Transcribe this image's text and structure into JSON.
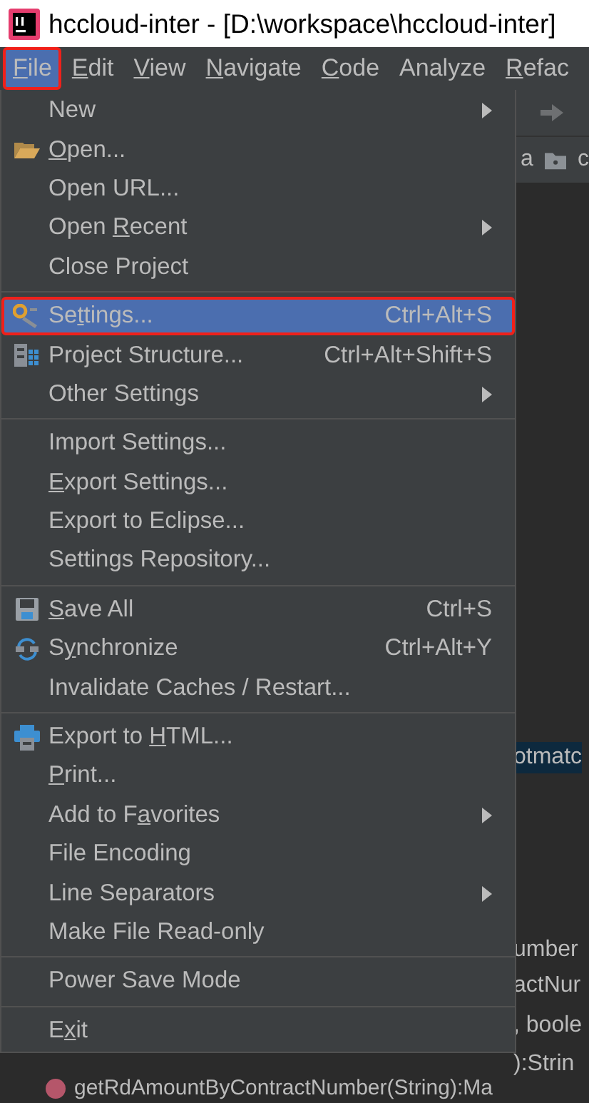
{
  "window": {
    "title": "hccloud-inter - [D:\\workspace\\hccloud-inter]"
  },
  "menu_bar": [
    {
      "label": [
        {
          "text": "F",
          "underlined": true
        },
        {
          "text": "ile",
          "underlined": false
        }
      ],
      "selected": true,
      "highlighted": true
    },
    {
      "label": [
        {
          "text": "E",
          "underlined": true
        },
        {
          "text": "dit",
          "underlined": false
        }
      ],
      "selected": false,
      "highlighted": false
    },
    {
      "label": [
        {
          "text": "V",
          "underlined": true
        },
        {
          "text": "iew",
          "underlined": false
        }
      ],
      "selected": false,
      "highlighted": false
    },
    {
      "label": [
        {
          "text": "N",
          "underlined": true
        },
        {
          "text": "avigate",
          "underlined": false
        }
      ],
      "selected": false,
      "highlighted": false
    },
    {
      "label": [
        {
          "text": "C",
          "underlined": true
        },
        {
          "text": "ode",
          "underlined": false
        }
      ],
      "selected": false,
      "highlighted": false
    },
    {
      "label": [
        {
          "text": "Analyze",
          "underlined": false
        }
      ],
      "selected": false,
      "highlighted": false
    },
    {
      "label": [
        {
          "text": "R",
          "underlined": true
        },
        {
          "text": "efac",
          "underlined": false
        }
      ],
      "selected": false,
      "highlighted": false
    }
  ],
  "file_menu": [
    {
      "kind": "item",
      "label": [
        {
          "text": "New",
          "underlined": false
        }
      ],
      "submenu": true,
      "selected": false,
      "highlighted": false
    },
    {
      "kind": "item",
      "label": [
        {
          "text": "O",
          "underlined": true
        },
        {
          "text": "pen...",
          "underlined": false
        }
      ],
      "submenu": false,
      "selected": false,
      "highlighted": false
    },
    {
      "kind": "item",
      "label": [
        {
          "text": "Open URL...",
          "underlined": false
        }
      ],
      "submenu": false,
      "selected": false,
      "highlighted": false
    },
    {
      "kind": "item",
      "label": [
        {
          "text": "Open ",
          "underlined": false
        },
        {
          "text": "R",
          "underlined": true
        },
        {
          "text": "ecent",
          "underlined": false
        }
      ],
      "submenu": true,
      "selected": false,
      "highlighted": false
    },
    {
      "kind": "item",
      "label": [
        {
          "text": "Close Project",
          "underlined": false
        }
      ],
      "submenu": false,
      "selected": false,
      "highlighted": false
    },
    {
      "kind": "separator"
    },
    {
      "kind": "item",
      "label": [
        {
          "text": "Se",
          "underlined": false
        },
        {
          "text": "t",
          "underlined": true
        },
        {
          "text": "tings...",
          "underlined": false
        }
      ],
      "shortcut": "Ctrl+Alt+S",
      "submenu": false,
      "selected": true,
      "highlighted": true
    },
    {
      "kind": "item",
      "label": [
        {
          "text": "Project Structure...",
          "underlined": false
        }
      ],
      "shortcut": "Ctrl+Alt+Shift+S",
      "submenu": false,
      "selected": false,
      "highlighted": false
    },
    {
      "kind": "item",
      "label": [
        {
          "text": "Other Settings",
          "underlined": false
        }
      ],
      "submenu": true,
      "selected": false,
      "highlighted": false
    },
    {
      "kind": "separator"
    },
    {
      "kind": "item",
      "label": [
        {
          "text": "Import Settings...",
          "underlined": false
        }
      ],
      "submenu": false,
      "selected": false,
      "highlighted": false
    },
    {
      "kind": "item",
      "label": [
        {
          "text": "E",
          "underlined": true
        },
        {
          "text": "xport Settings...",
          "underlined": false
        }
      ],
      "submenu": false,
      "selected": false,
      "highlighted": false
    },
    {
      "kind": "item",
      "label": [
        {
          "text": "Export to Eclipse...",
          "underlined": false
        }
      ],
      "submenu": false,
      "selected": false,
      "highlighted": false
    },
    {
      "kind": "item",
      "label": [
        {
          "text": "Settings Repository...",
          "underlined": false
        }
      ],
      "submenu": false,
      "selected": false,
      "highlighted": false
    },
    {
      "kind": "separator"
    },
    {
      "kind": "item",
      "label": [
        {
          "text": "S",
          "underlined": true
        },
        {
          "text": "ave All",
          "underlined": false
        }
      ],
      "shortcut": "Ctrl+S",
      "submenu": false,
      "selected": false,
      "highlighted": false
    },
    {
      "kind": "item",
      "label": [
        {
          "text": "S",
          "underlined": false
        },
        {
          "text": "y",
          "underlined": true
        },
        {
          "text": "nchronize",
          "underlined": false
        }
      ],
      "shortcut": "Ctrl+Alt+Y",
      "submenu": false,
      "selected": false,
      "highlighted": false
    },
    {
      "kind": "item",
      "label": [
        {
          "text": "Invalidate Caches / Restart...",
          "underlined": false
        }
      ],
      "submenu": false,
      "selected": false,
      "highlighted": false
    },
    {
      "kind": "separator"
    },
    {
      "kind": "item",
      "label": [
        {
          "text": "Export to ",
          "underlined": false
        },
        {
          "text": "H",
          "underlined": true
        },
        {
          "text": "TML...",
          "underlined": false
        }
      ],
      "submenu": false,
      "selected": false,
      "highlighted": false
    },
    {
      "kind": "item",
      "label": [
        {
          "text": "P",
          "underlined": true
        },
        {
          "text": "rint...",
          "underlined": false
        }
      ],
      "submenu": false,
      "selected": false,
      "highlighted": false
    },
    {
      "kind": "item",
      "label": [
        {
          "text": "Add to F",
          "underlined": false
        },
        {
          "text": "a",
          "underlined": true
        },
        {
          "text": "vorites",
          "underlined": false
        }
      ],
      "submenu": true,
      "selected": false,
      "highlighted": false
    },
    {
      "kind": "item",
      "label": [
        {
          "text": "File Encoding",
          "underlined": false
        }
      ],
      "submenu": false,
      "selected": false,
      "highlighted": false
    },
    {
      "kind": "item",
      "label": [
        {
          "text": "Line Separators",
          "underlined": false
        }
      ],
      "submenu": true,
      "selected": false,
      "highlighted": false
    },
    {
      "kind": "item",
      "label": [
        {
          "text": "Make File Read-only",
          "underlined": false
        }
      ],
      "submenu": false,
      "selected": false,
      "highlighted": false
    },
    {
      "kind": "separator"
    },
    {
      "kind": "item",
      "label": [
        {
          "text": "Power Save Mode",
          "underlined": false
        }
      ],
      "submenu": false,
      "selected": false,
      "highlighted": false
    },
    {
      "kind": "separator"
    },
    {
      "kind": "item",
      "label": [
        {
          "text": "E",
          "underlined": false
        },
        {
          "text": "x",
          "underlined": true
        },
        {
          "text": "it",
          "underlined": false
        }
      ],
      "submenu": false,
      "selected": false,
      "highlighted": false
    }
  ],
  "editor": {
    "breadcrumb": [
      "a",
      "c"
    ],
    "code_fragments": [
      {
        "text": "otmatc",
        "selected": true
      },
      {
        "text": "umber",
        "selected": false
      },
      {
        "text": "actNur",
        "selected": false
      },
      {
        "text": ", boole",
        "selected": false
      },
      {
        "text": "):Strin",
        "selected": false
      }
    ],
    "bottom_line": "getRdAmountByContractNumber(String):Ma"
  }
}
